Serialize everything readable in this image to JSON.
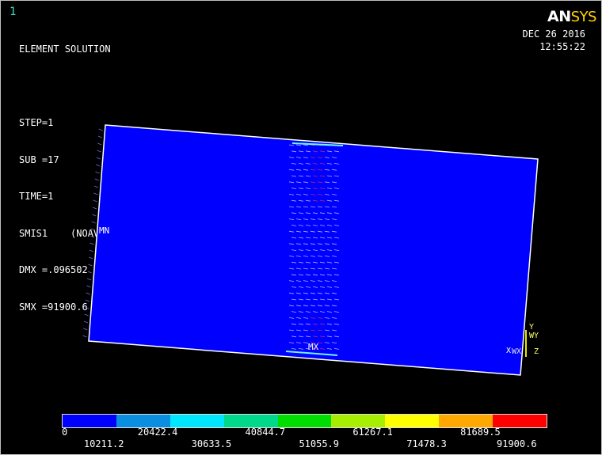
{
  "window_number": "1",
  "info_lines": [
    "ELEMENT SOLUTION",
    "",
    "STEP=1",
    "SUB =17",
    "TIME=1",
    "SMIS1    (NOAVG)",
    "DMX =.096502",
    "SMX =91900.6"
  ],
  "logo": {
    "a": "AN",
    "b": "SYS"
  },
  "date": "DEC 26 2016",
  "time": "12:55:22",
  "labels": {
    "min": "MN",
    "max": "MX"
  },
  "triad": {
    "y": "Y",
    "wy": "WY",
    "x": "X",
    "wx": "WX",
    "z": "Z"
  },
  "legend": {
    "colors": [
      "#0000ff",
      "#0a8fe0",
      "#00e6ff",
      "#00d88a",
      "#00dd00",
      "#a8ee00",
      "#ffff00",
      "#ffa800",
      "#ff0000"
    ],
    "top_values": [
      "0",
      "20422.4",
      "40844.7",
      "61267.1",
      "81689.5"
    ],
    "bottom_values": [
      "10211.2",
      "30633.5",
      "51055.9",
      "71478.3",
      "91900.6"
    ]
  }
}
